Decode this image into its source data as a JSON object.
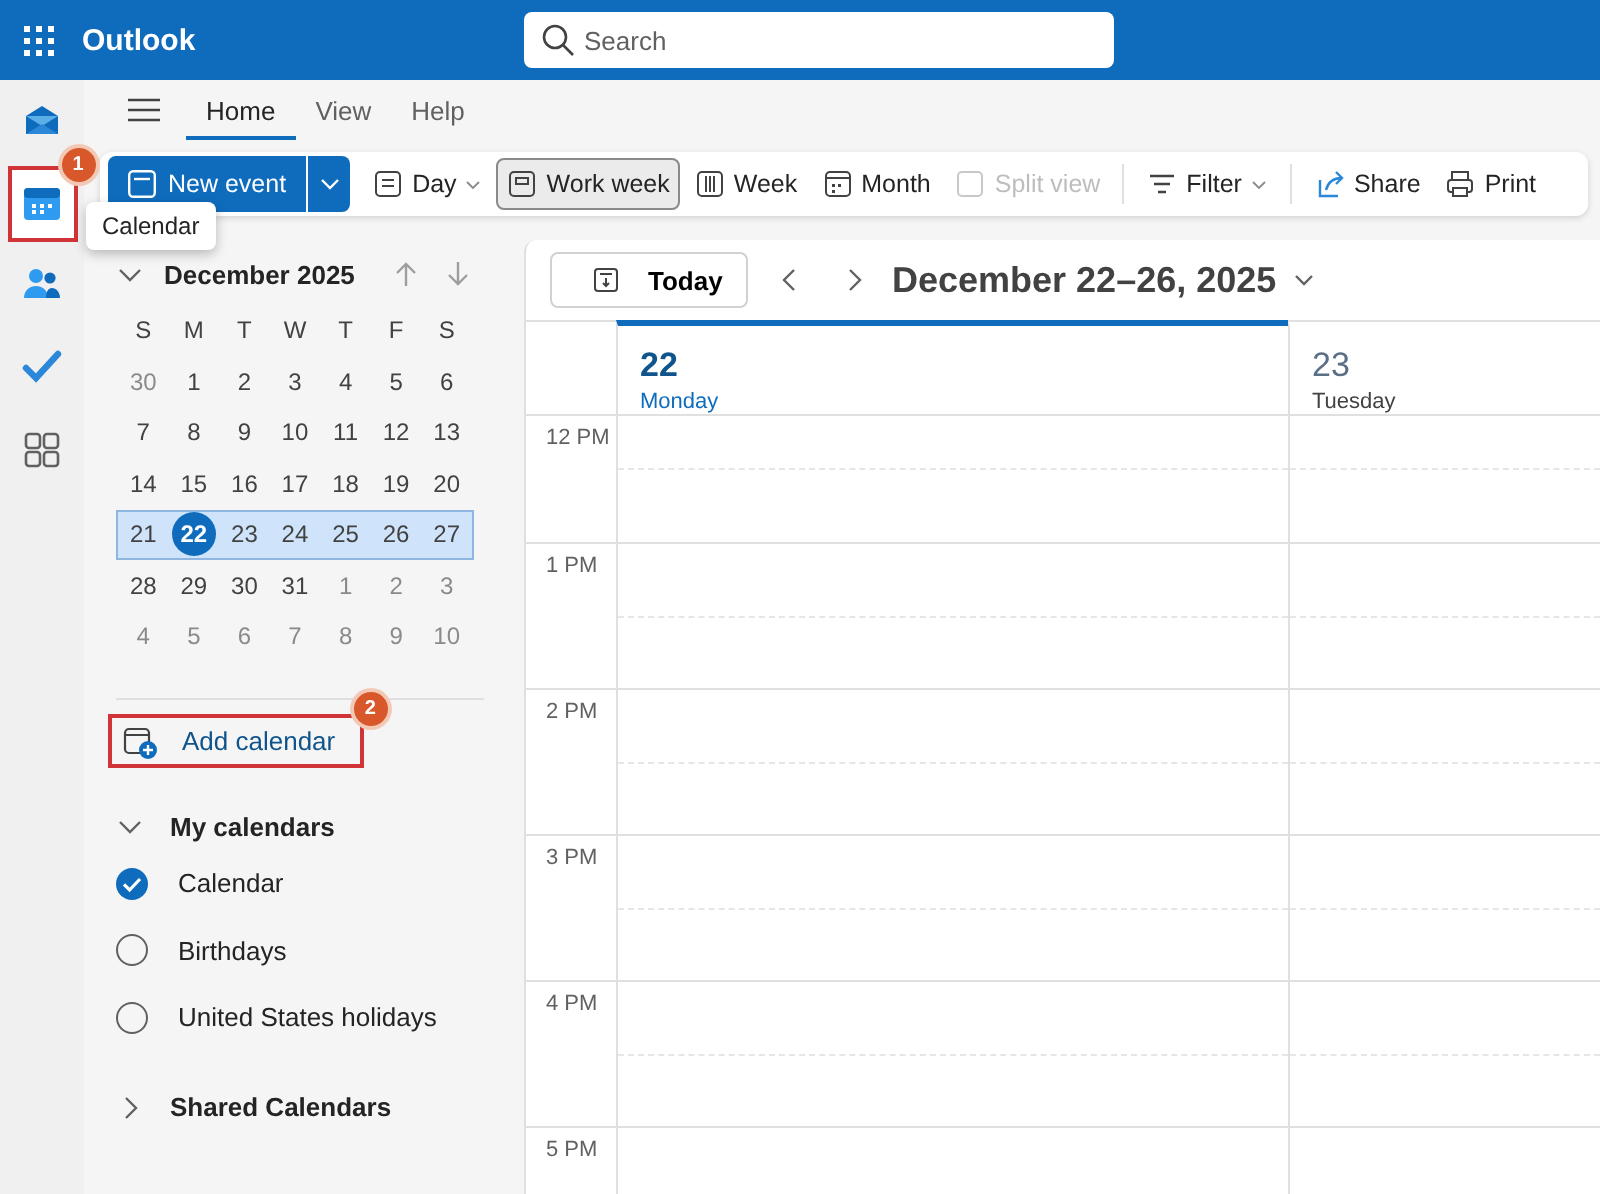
{
  "app": {
    "title": "Outlook"
  },
  "search": {
    "placeholder": "Search"
  },
  "rail": [
    {
      "kind": "mail",
      "selected": false,
      "highlighted": false
    },
    {
      "kind": "calendar",
      "selected": true,
      "highlighted": true,
      "badge": "1",
      "tooltip": "Calendar"
    },
    {
      "kind": "people",
      "selected": false,
      "highlighted": false
    },
    {
      "kind": "todo",
      "selected": false,
      "highlighted": false
    },
    {
      "kind": "apps",
      "selected": false,
      "highlighted": false
    }
  ],
  "tabs": [
    {
      "label": "Home",
      "selected": true
    },
    {
      "label": "View",
      "selected": false
    },
    {
      "label": "Help",
      "selected": false
    }
  ],
  "toolbar": {
    "new_event": "New event",
    "items": [
      {
        "kind": "day",
        "label": "Day",
        "dropdown": true,
        "selected": false,
        "disabled": false
      },
      {
        "kind": "workweek",
        "label": "Work week",
        "dropdown": false,
        "selected": true,
        "disabled": false
      },
      {
        "kind": "week",
        "label": "Week",
        "dropdown": false,
        "selected": false,
        "disabled": false
      },
      {
        "kind": "month",
        "label": "Month",
        "dropdown": false,
        "selected": false,
        "disabled": false
      },
      {
        "kind": "split",
        "label": "Split view",
        "dropdown": false,
        "selected": false,
        "disabled": true
      },
      {
        "kind": "filter",
        "label": "Filter",
        "dropdown": true,
        "selected": false,
        "disabled": false
      },
      {
        "kind": "share",
        "label": "Share",
        "dropdown": false,
        "selected": false,
        "disabled": false
      },
      {
        "kind": "print",
        "label": "Print",
        "dropdown": false,
        "selected": false,
        "disabled": false
      }
    ]
  },
  "mini_calendar": {
    "title": "December 2025",
    "expanded": true,
    "weekdays": [
      "S",
      "M",
      "T",
      "W",
      "T",
      "F",
      "S"
    ],
    "weeks": [
      {
        "selected": false,
        "days": [
          {
            "label": "30",
            "outside": true,
            "today": false
          },
          {
            "label": "1",
            "outside": false,
            "today": false
          },
          {
            "label": "2",
            "outside": false,
            "today": false
          },
          {
            "label": "3",
            "outside": false,
            "today": false
          },
          {
            "label": "4",
            "outside": false,
            "today": false
          },
          {
            "label": "5",
            "outside": false,
            "today": false
          },
          {
            "label": "6",
            "outside": false,
            "today": false
          }
        ]
      },
      {
        "selected": false,
        "days": [
          {
            "label": "7",
            "outside": false,
            "today": false
          },
          {
            "label": "8",
            "outside": false,
            "today": false
          },
          {
            "label": "9",
            "outside": false,
            "today": false
          },
          {
            "label": "10",
            "outside": false,
            "today": false
          },
          {
            "label": "11",
            "outside": false,
            "today": false
          },
          {
            "label": "12",
            "outside": false,
            "today": false
          },
          {
            "label": "13",
            "outside": false,
            "today": false
          }
        ]
      },
      {
        "selected": false,
        "days": [
          {
            "label": "14",
            "outside": false,
            "today": false
          },
          {
            "label": "15",
            "outside": false,
            "today": false
          },
          {
            "label": "16",
            "outside": false,
            "today": false
          },
          {
            "label": "17",
            "outside": false,
            "today": false
          },
          {
            "label": "18",
            "outside": false,
            "today": false
          },
          {
            "label": "19",
            "outside": false,
            "today": false
          },
          {
            "label": "20",
            "outside": false,
            "today": false
          }
        ]
      },
      {
        "selected": true,
        "days": [
          {
            "label": "21",
            "outside": false,
            "today": false
          },
          {
            "label": "22",
            "outside": false,
            "today": true
          },
          {
            "label": "23",
            "outside": false,
            "today": false
          },
          {
            "label": "24",
            "outside": false,
            "today": false
          },
          {
            "label": "25",
            "outside": false,
            "today": false
          },
          {
            "label": "26",
            "outside": false,
            "today": false
          },
          {
            "label": "27",
            "outside": false,
            "today": false
          }
        ]
      },
      {
        "selected": false,
        "days": [
          {
            "label": "28",
            "outside": false,
            "today": false
          },
          {
            "label": "29",
            "outside": false,
            "today": false
          },
          {
            "label": "30",
            "outside": false,
            "today": false
          },
          {
            "label": "31",
            "outside": false,
            "today": false
          },
          {
            "label": "1",
            "outside": true,
            "today": false
          },
          {
            "label": "2",
            "outside": true,
            "today": false
          },
          {
            "label": "3",
            "outside": true,
            "today": false
          }
        ]
      },
      {
        "selected": false,
        "days": [
          {
            "label": "4",
            "outside": true,
            "today": false
          },
          {
            "label": "5",
            "outside": true,
            "today": false
          },
          {
            "label": "6",
            "outside": true,
            "today": false
          },
          {
            "label": "7",
            "outside": true,
            "today": false
          },
          {
            "label": "8",
            "outside": true,
            "today": false
          },
          {
            "label": "9",
            "outside": true,
            "today": false
          },
          {
            "label": "10",
            "outside": true,
            "today": false
          }
        ]
      }
    ]
  },
  "add_calendar": {
    "label": "Add calendar",
    "badge": "2",
    "highlighted": true
  },
  "calendar_groups": [
    {
      "label": "My calendars",
      "expanded": true,
      "items": [
        {
          "label": "Calendar",
          "checked": true
        },
        {
          "label": "Birthdays",
          "checked": false
        },
        {
          "label": "United States holidays",
          "checked": false
        }
      ]
    },
    {
      "label": "Shared Calendars",
      "expanded": false
    }
  ],
  "view": {
    "today_button": "Today",
    "range": "December 22–26, 2025",
    "days": [
      {
        "number": "22",
        "name": "Monday",
        "today": true
      },
      {
        "number": "23",
        "name": "Tuesday",
        "today": false
      }
    ],
    "hours": [
      "12 PM",
      "1 PM",
      "2 PM",
      "3 PM",
      "4 PM",
      "5 PM"
    ]
  }
}
